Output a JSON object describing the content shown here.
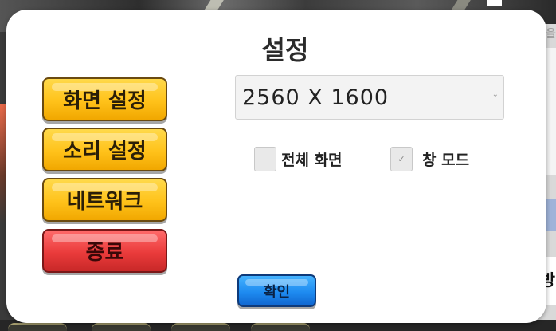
{
  "dialog": {
    "title": "설정"
  },
  "menu": {
    "items": [
      {
        "label": "화면 설정",
        "color": "#ffc21a"
      },
      {
        "label": "소리 설정",
        "color": "#ffc21a"
      },
      {
        "label": "네트워크",
        "color": "#ffc21a"
      },
      {
        "label": "종료",
        "color": "#ea3b3b"
      }
    ]
  },
  "display": {
    "resolution": {
      "selected": "2560 X 1600",
      "caret_icon": "chevron-down-icon"
    },
    "fullscreen": {
      "label": "전체 화면",
      "checked": false
    },
    "windowed": {
      "label": "창 모드",
      "checked": true,
      "check_icon": "checkmark-icon"
    }
  },
  "confirm": {
    "label": "확인",
    "color": "#1e8bf0"
  },
  "background": {
    "right_glyph_top": "을",
    "right_glyph": "방"
  }
}
